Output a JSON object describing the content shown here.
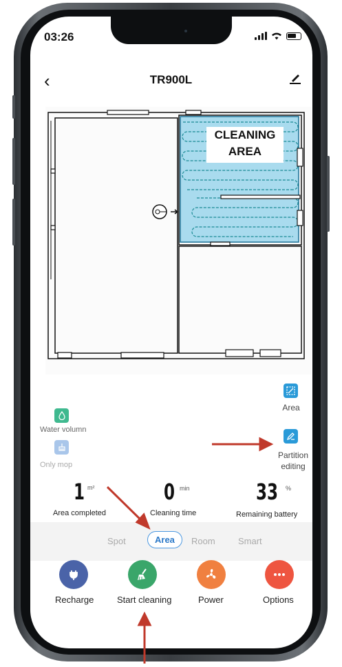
{
  "status_bar": {
    "time": "03:26"
  },
  "header": {
    "title": "TR900L"
  },
  "map": {
    "cleaning_area_label_line1": "CLEANING",
    "cleaning_area_label_line2": "AREA"
  },
  "controls": {
    "area_label": "Area",
    "partition_label_line1": "Partition",
    "partition_label_line2": "editing",
    "water_label": "Water volumn",
    "mop_label": "Only mop"
  },
  "stats": [
    {
      "value": "1",
      "unit": "m²",
      "label": "Area completed"
    },
    {
      "value": "0",
      "unit": "min",
      "label": "Cleaning time"
    },
    {
      "value": "33",
      "unit": "%",
      "label": "Remaining battery"
    }
  ],
  "modes": [
    {
      "label": "Spot",
      "active": false
    },
    {
      "label": "Area",
      "active": true
    },
    {
      "label": "Room",
      "active": false
    },
    {
      "label": "Smart",
      "active": false
    }
  ],
  "actions": [
    {
      "label": "Recharge",
      "icon": "plug-icon",
      "color": "#4a63a8"
    },
    {
      "label": "Start cleaning",
      "icon": "broom-icon",
      "color": "#3aa66a"
    },
    {
      "label": "Power",
      "icon": "fan-icon",
      "color": "#f08040"
    },
    {
      "label": "Options",
      "icon": "more-dots-icon",
      "color": "#ee5540"
    }
  ],
  "colors": {
    "accent": "#2a9ad8",
    "cleaning_area": "#a9dbee",
    "annotation_arrow": "#c0392b"
  }
}
